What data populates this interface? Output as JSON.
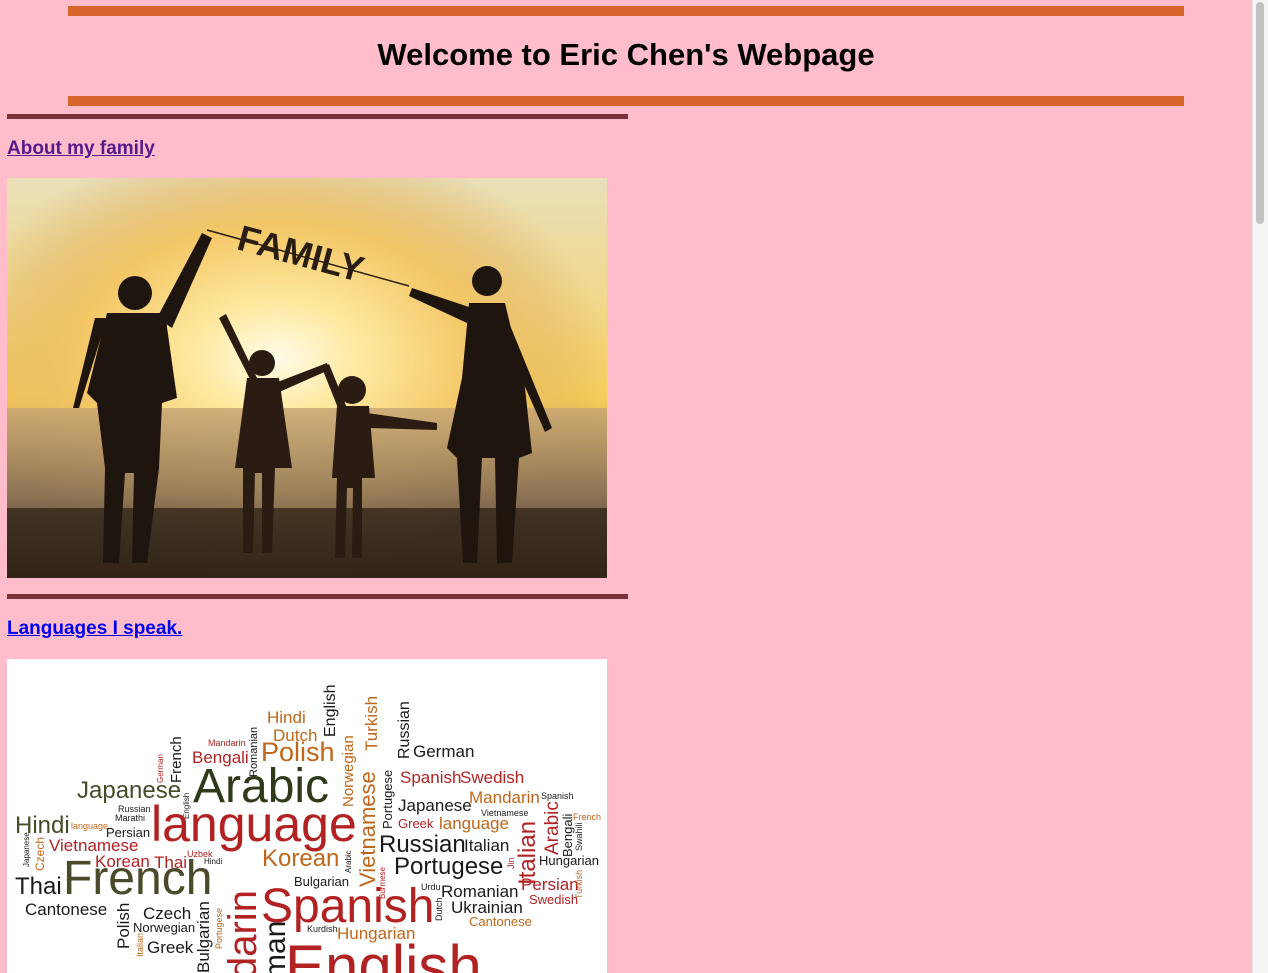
{
  "header": {
    "title": "Welcome to Eric Chen's Webpage"
  },
  "sections": [
    {
      "link_label": "About my family",
      "image_banner_text": "FAMILY"
    },
    {
      "link_label": "Languages I speak."
    }
  ],
  "word_cloud": [
    {
      "text": "Hindi",
      "color": "#c0661a"
    },
    {
      "text": "Dutch",
      "color": "#c0661a"
    },
    {
      "text": "English",
      "color": "#1a1a1a"
    },
    {
      "text": "Turkish",
      "color": "#c0661a"
    },
    {
      "text": "Russian",
      "color": "#1a1a1a"
    },
    {
      "text": "Mandarin",
      "color": "#b22222"
    },
    {
      "text": "Bengali",
      "color": "#b22222"
    },
    {
      "text": "Polish",
      "color": "#c0661a"
    },
    {
      "text": "Romanian",
      "color": "#1a1a1a"
    },
    {
      "text": "German",
      "color": "#1a1a1a"
    },
    {
      "text": "French",
      "color": "#1a1a1a"
    },
    {
      "text": "German",
      "color": "#b22222"
    },
    {
      "text": "Japanese",
      "color": "#4a4a2a"
    },
    {
      "text": "Arabic",
      "color": "#2e3a1a"
    },
    {
      "text": "Norwegian",
      "color": "#c0661a"
    },
    {
      "text": "Vietnamese",
      "color": "#c0661a"
    },
    {
      "text": "Portugese",
      "color": "#1a1a1a"
    },
    {
      "text": "Spanish",
      "color": "#b22222"
    },
    {
      "text": "Swedish",
      "color": "#b22222"
    },
    {
      "text": "Mandarin",
      "color": "#c0661a"
    },
    {
      "text": "Spanish",
      "color": "#1a1a1a"
    },
    {
      "text": "English",
      "color": "#1a1a1a"
    },
    {
      "text": "Russian",
      "color": "#1a1a1a"
    },
    {
      "text": "Marathi",
      "color": "#1a1a1a"
    },
    {
      "text": "Hindi",
      "color": "#4a4a2a"
    },
    {
      "text": "language",
      "color": "#c0661a"
    },
    {
      "text": "Persian",
      "color": "#1a1a1a"
    },
    {
      "text": "language",
      "color": "#b22222"
    },
    {
      "text": "Japanese",
      "color": "#1a1a1a"
    },
    {
      "text": "Vietnamese",
      "color": "#1a1a1a"
    },
    {
      "text": "Greek",
      "color": "#b22222"
    },
    {
      "text": "language",
      "color": "#c0661a"
    },
    {
      "text": "Arabic",
      "color": "#b22222"
    },
    {
      "text": "Bengali",
      "color": "#1a1a1a"
    },
    {
      "text": "Swahili",
      "color": "#1a1a1a"
    },
    {
      "text": "French",
      "color": "#c0661a"
    },
    {
      "text": "Italian",
      "color": "#b22222"
    },
    {
      "text": "Vietnamese",
      "color": "#b22222"
    },
    {
      "text": "Korean",
      "color": "#c0661a"
    },
    {
      "text": "Uzbek",
      "color": "#b22222"
    },
    {
      "text": "Japanese",
      "color": "#1a1a1a"
    },
    {
      "text": "Czech",
      "color": "#c0661a"
    },
    {
      "text": "Korean",
      "color": "#b22222"
    },
    {
      "text": "Thai",
      "color": "#b22222"
    },
    {
      "text": "Hindi",
      "color": "#1a1a1a"
    },
    {
      "text": "Arabic",
      "color": "#1a1a1a"
    },
    {
      "text": "Russian",
      "color": "#1a1a1a"
    },
    {
      "text": "Italian",
      "color": "#1a1a1a"
    },
    {
      "text": "Hungarian",
      "color": "#1a1a1a"
    },
    {
      "text": "Thai",
      "color": "#1a1a1a"
    },
    {
      "text": "French",
      "color": "#4a4a2a"
    },
    {
      "text": "darin",
      "color": "#b22222"
    },
    {
      "text": "Bulgarian",
      "color": "#1a1a1a"
    },
    {
      "text": "Portugese",
      "color": "#1a1a1a"
    },
    {
      "text": "Jin",
      "color": "#b22222"
    },
    {
      "text": "Persian",
      "color": "#b22222"
    },
    {
      "text": "Turkish",
      "color": "#c0661a"
    },
    {
      "text": "Burmese",
      "color": "#b22222"
    },
    {
      "text": "Urdu",
      "color": "#1a1a1a"
    },
    {
      "text": "Romanian",
      "color": "#1a1a1a"
    },
    {
      "text": "Swedish",
      "color": "#b22222"
    },
    {
      "text": "Cantonese",
      "color": "#1a1a1a"
    },
    {
      "text": "Spanish",
      "color": "#b22222"
    },
    {
      "text": "Dutch",
      "color": "#1a1a1a"
    },
    {
      "text": "Ukrainian",
      "color": "#1a1a1a"
    },
    {
      "text": "Czech",
      "color": "#1a1a1a"
    },
    {
      "text": "Cantonese",
      "color": "#c0661a"
    },
    {
      "text": "Polish",
      "color": "#1a1a1a"
    },
    {
      "text": "Norwegian",
      "color": "#1a1a1a"
    },
    {
      "text": "Kurdish",
      "color": "#1a1a1a"
    },
    {
      "text": "Hungarian",
      "color": "#c0661a"
    },
    {
      "text": "Italian",
      "color": "#c0661a"
    },
    {
      "text": "Greek",
      "color": "#1a1a1a"
    },
    {
      "text": "Bulgarian",
      "color": "#1a1a1a"
    },
    {
      "text": "Portugese",
      "color": "#c0661a"
    },
    {
      "text": "man",
      "color": "#1a1a1a"
    },
    {
      "text": "English",
      "color": "#b22222"
    }
  ]
}
